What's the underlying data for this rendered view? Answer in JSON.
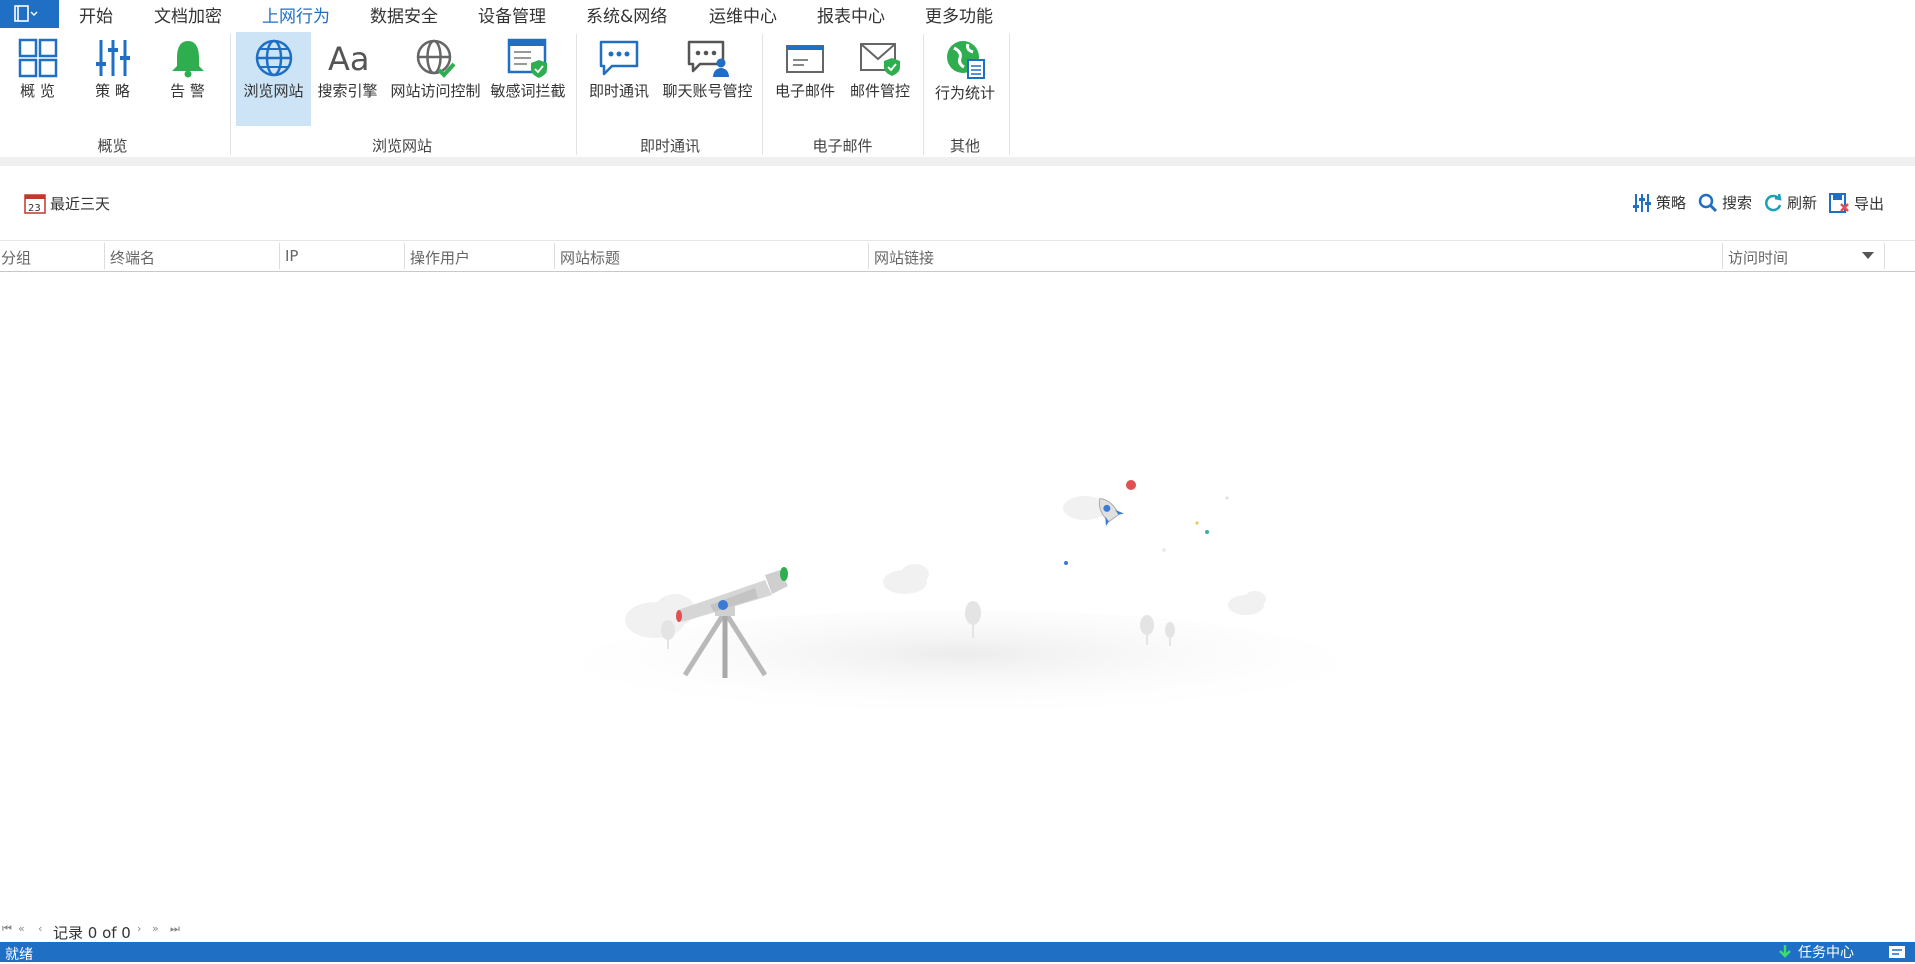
{
  "menu": {
    "items": [
      "开始",
      "文档加密",
      "上网行为",
      "数据安全",
      "设备管理",
      "系统&网络",
      "运维中心",
      "报表中心",
      "更多功能"
    ],
    "active_index": 2
  },
  "ribbon": {
    "buttons": [
      {
        "label": "概 览",
        "icon": "overview-grid-icon"
      },
      {
        "label": "策 略",
        "icon": "policy-sliders-icon"
      },
      {
        "label": "告 警",
        "icon": "alert-bell-icon"
      },
      {
        "label": "浏览网站",
        "icon": "globe-icon",
        "selected": true
      },
      {
        "label": "搜索引擎",
        "icon": "search-engine-aa-icon"
      },
      {
        "label": "网站访问控制",
        "icon": "globe-check-icon"
      },
      {
        "label": "敏感词拦截",
        "icon": "window-shield-icon"
      },
      {
        "label": "即时通讯",
        "icon": "chat-bubble-icon"
      },
      {
        "label": "聊天账号管控",
        "icon": "chat-user-icon"
      },
      {
        "label": "电子邮件",
        "icon": "envelope-icon"
      },
      {
        "label": "邮件管控",
        "icon": "envelope-shield-icon"
      },
      {
        "label": "行为统计",
        "icon": "globe-stats-icon"
      }
    ],
    "groups": [
      "概览",
      "浏览网站",
      "即时通讯",
      "电子邮件",
      "其他"
    ]
  },
  "toolbar": {
    "date_filter": "最近三天",
    "date_icon_text": "23",
    "policy": "策略",
    "search": "搜索",
    "refresh": "刷新",
    "export": "导出"
  },
  "table": {
    "columns": [
      "分组",
      "终端名",
      "IP",
      "操作用户",
      "网站标题",
      "网站链接",
      "访问时间"
    ],
    "rows": []
  },
  "pager": {
    "record_text": "记录 0 of 0"
  },
  "status": {
    "left": "就绪",
    "right": "任务中心"
  },
  "colors": {
    "accent": "#1f6fc5",
    "selected_bg": "#cde4f7",
    "green": "#2eae4f"
  }
}
